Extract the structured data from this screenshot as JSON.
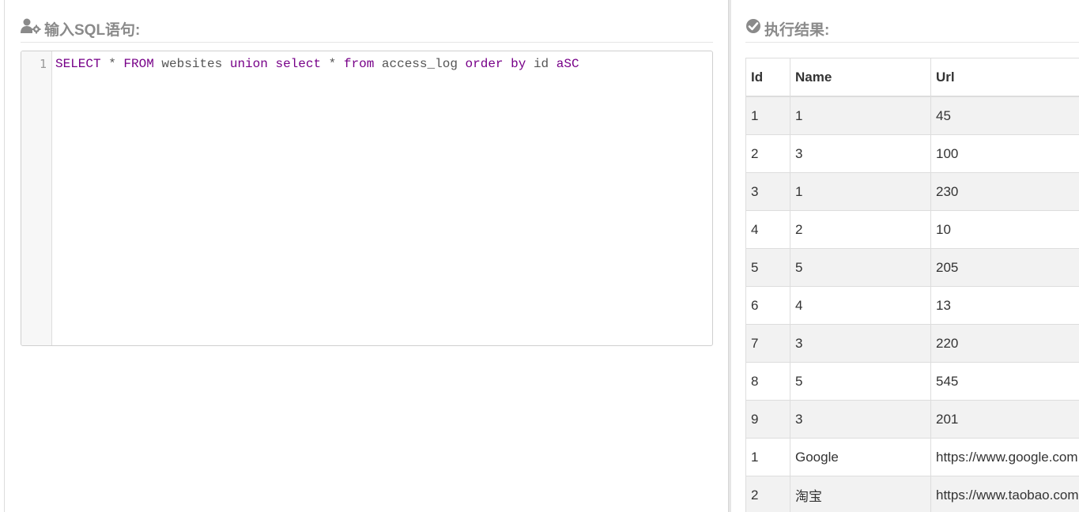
{
  "left_panel": {
    "title": "输入SQL语句:"
  },
  "right_panel": {
    "title": "执行结果:"
  },
  "editor": {
    "line_number": "1",
    "tokens": {
      "t1": "SELECT",
      "t2": " * ",
      "t3": "FROM",
      "t4": " websites ",
      "t5": "union",
      "t6": " ",
      "t7": "select",
      "t8": " * ",
      "t9": "from",
      "t10": " access_log ",
      "t11": "order",
      "t12": " ",
      "t13": "by",
      "t14": " id ",
      "t15": "aSC"
    }
  },
  "results": {
    "headers": [
      "Id",
      "Name",
      "Url"
    ],
    "rows": [
      [
        "1",
        "1",
        "45"
      ],
      [
        "2",
        "3",
        "100"
      ],
      [
        "3",
        "1",
        "230"
      ],
      [
        "4",
        "2",
        "10"
      ],
      [
        "5",
        "5",
        "205"
      ],
      [
        "6",
        "4",
        "13"
      ],
      [
        "7",
        "3",
        "220"
      ],
      [
        "8",
        "5",
        "545"
      ],
      [
        "9",
        "3",
        "201"
      ],
      [
        "1",
        "Google",
        "https://www.google.com"
      ],
      [
        "2",
        "淘宝",
        "https://www.taobao.com"
      ]
    ]
  },
  "colors": {
    "heading": "#8a8a8a",
    "keyword": "#770088",
    "stripe": "#f2f2f2"
  }
}
